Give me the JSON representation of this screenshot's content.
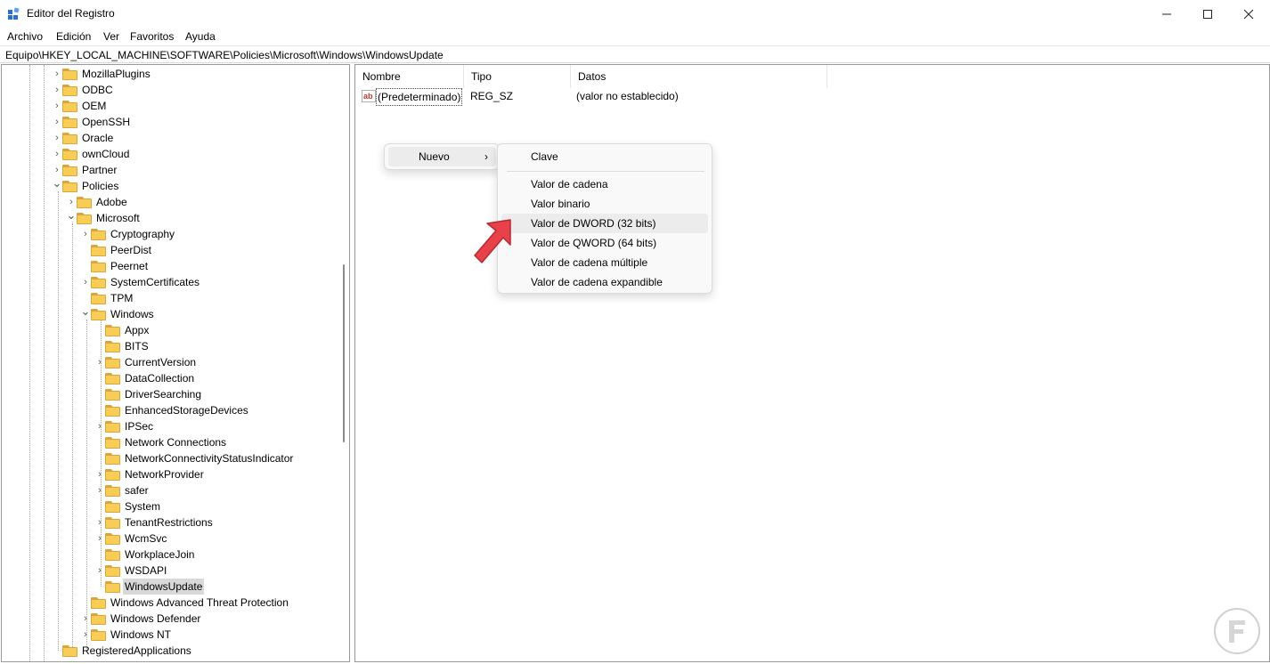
{
  "window": {
    "title": "Editor del Registro",
    "minimize_icon": "minimize-icon",
    "maximize_icon": "maximize-icon",
    "close_icon": "close-icon"
  },
  "menu": [
    "Archivo",
    "Edición",
    "Ver",
    "Favoritos",
    "Ayuda"
  ],
  "address": "Equipo\\HKEY_LOCAL_MACHINE\\SOFTWARE\\Policies\\Microsoft\\Windows\\WindowsUpdate",
  "tree": [
    {
      "label": "MozillaPlugins",
      "level": 0,
      "chevron": "right"
    },
    {
      "label": "ODBC",
      "level": 0,
      "chevron": "right"
    },
    {
      "label": "OEM",
      "level": 0,
      "chevron": "right"
    },
    {
      "label": "OpenSSH",
      "level": 0,
      "chevron": "right"
    },
    {
      "label": "Oracle",
      "level": 0,
      "chevron": "right"
    },
    {
      "label": "ownCloud",
      "level": 0,
      "chevron": "right"
    },
    {
      "label": "Partner",
      "level": 0,
      "chevron": "right"
    },
    {
      "label": "Policies",
      "level": 0,
      "chevron": "down"
    },
    {
      "label": "Adobe",
      "level": 1,
      "chevron": "right"
    },
    {
      "label": "Microsoft",
      "level": 1,
      "chevron": "down"
    },
    {
      "label": "Cryptography",
      "level": 2,
      "chevron": "right"
    },
    {
      "label": "PeerDist",
      "level": 2,
      "chevron": "none"
    },
    {
      "label": "Peernet",
      "level": 2,
      "chevron": "none"
    },
    {
      "label": "SystemCertificates",
      "level": 2,
      "chevron": "right"
    },
    {
      "label": "TPM",
      "level": 2,
      "chevron": "none"
    },
    {
      "label": "Windows",
      "level": 2,
      "chevron": "down"
    },
    {
      "label": "Appx",
      "level": 3,
      "chevron": "none"
    },
    {
      "label": "BITS",
      "level": 3,
      "chevron": "none"
    },
    {
      "label": "CurrentVersion",
      "level": 3,
      "chevron": "right"
    },
    {
      "label": "DataCollection",
      "level": 3,
      "chevron": "none"
    },
    {
      "label": "DriverSearching",
      "level": 3,
      "chevron": "none"
    },
    {
      "label": "EnhancedStorageDevices",
      "level": 3,
      "chevron": "none"
    },
    {
      "label": "IPSec",
      "level": 3,
      "chevron": "right"
    },
    {
      "label": "Network Connections",
      "level": 3,
      "chevron": "none"
    },
    {
      "label": "NetworkConnectivityStatusIndicator",
      "level": 3,
      "chevron": "none"
    },
    {
      "label": "NetworkProvider",
      "level": 3,
      "chevron": "right"
    },
    {
      "label": "safer",
      "level": 3,
      "chevron": "right"
    },
    {
      "label": "System",
      "level": 3,
      "chevron": "none"
    },
    {
      "label": "TenantRestrictions",
      "level": 3,
      "chevron": "right"
    },
    {
      "label": "WcmSvc",
      "level": 3,
      "chevron": "right"
    },
    {
      "label": "WorkplaceJoin",
      "level": 3,
      "chevron": "none"
    },
    {
      "label": "WSDAPI",
      "level": 3,
      "chevron": "right"
    },
    {
      "label": "WindowsUpdate",
      "level": 3,
      "chevron": "none",
      "selected": true
    },
    {
      "label": "Windows Advanced Threat Protection",
      "level": 2,
      "chevron": "none"
    },
    {
      "label": "Windows Defender",
      "level": 2,
      "chevron": "right"
    },
    {
      "label": "Windows NT",
      "level": 2,
      "chevron": "right"
    },
    {
      "label": "RegisteredApplications",
      "level": 0,
      "chevron": "none"
    }
  ],
  "list": {
    "columns": [
      "Nombre",
      "Tipo",
      "Datos"
    ],
    "rows": [
      {
        "icon": "string-value-icon",
        "name": "(Predeterminado)",
        "type": "REG_SZ",
        "data": "(valor no establecido)"
      }
    ]
  },
  "context_menu": {
    "nuevo_label": "Nuevo",
    "submenu": [
      {
        "label": "Clave",
        "hover": false
      },
      {
        "separator": true
      },
      {
        "label": "Valor de cadena",
        "hover": false
      },
      {
        "label": "Valor binario",
        "hover": false
      },
      {
        "label": "Valor de DWORD (32 bits)",
        "hover": true
      },
      {
        "label": "Valor de QWORD (64 bits)",
        "hover": false
      },
      {
        "label": "Valor de cadena múltiple",
        "hover": false
      },
      {
        "label": "Valor de cadena expandible",
        "hover": false
      }
    ]
  },
  "colors": {
    "folder_fill": "#f7cd55",
    "selection": "#d9d9d9",
    "annotation_arrow": "#e8414a"
  }
}
